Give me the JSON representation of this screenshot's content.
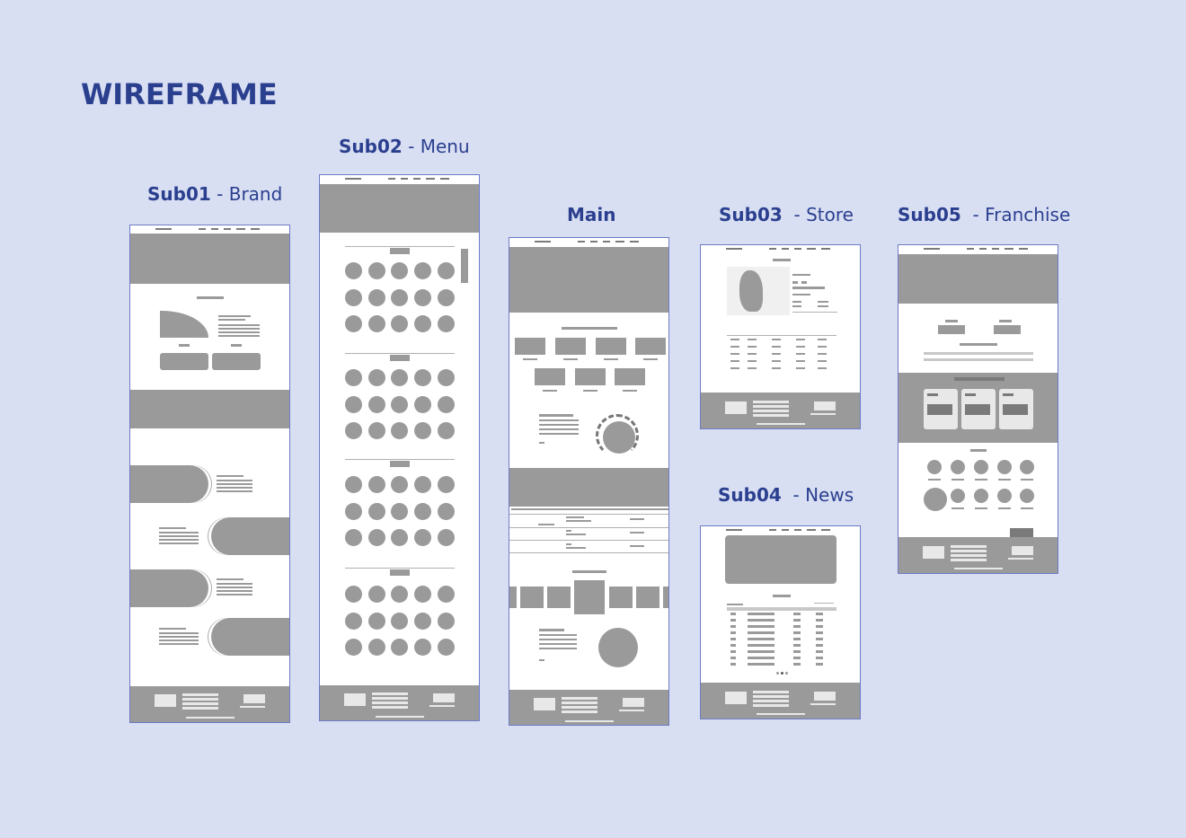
{
  "page": {
    "title": "WIREFRAME"
  },
  "wireframes": {
    "sub01": {
      "code": "Sub01",
      "sep": " - ",
      "name": "Brand"
    },
    "sub02": {
      "code": "Sub02",
      "sep": " - ",
      "name": "Menu"
    },
    "main": {
      "code": "Main"
    },
    "sub03": {
      "code": "Sub03",
      "sep": "  - ",
      "name": "Store"
    },
    "sub04": {
      "code": "Sub04",
      "sep": "  - ",
      "name": "News"
    },
    "sub05": {
      "code": "Sub05",
      "sep": "  - ",
      "name": "Franchise"
    }
  },
  "colors": {
    "background": "#d8dff3",
    "accent": "#2b3f8f",
    "frame_border": "#6d7bc4",
    "placeholder": "#9a9a9a"
  }
}
